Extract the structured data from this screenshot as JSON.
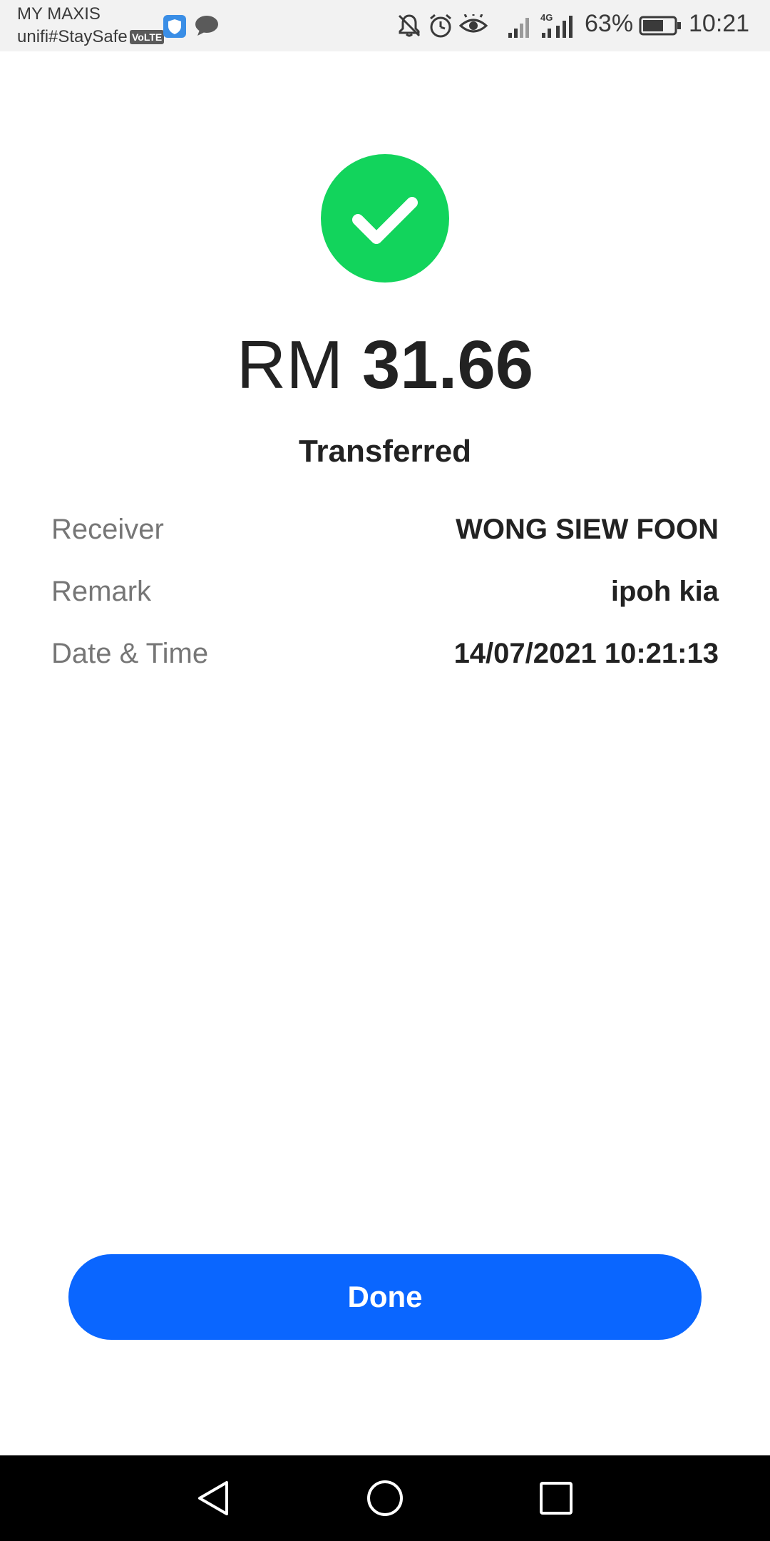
{
  "status_bar": {
    "carrier_line1": "MY MAXIS",
    "carrier_line2": "unifi#StaySafe",
    "volte_badge": "VoLTE",
    "network_badge": "4G",
    "battery_percent": "63%",
    "time": "10:21",
    "icons": [
      "shield-icon",
      "chat-icon",
      "mute-icon",
      "alarm-icon",
      "eye-icon",
      "signal-icon",
      "signal-4g-icon",
      "battery-icon"
    ]
  },
  "receipt": {
    "status_icon": "check-icon",
    "currency": "RM",
    "amount": "31.66",
    "status": "Transferred",
    "details": [
      {
        "label": "Receiver",
        "value": "WONG SIEW FOON"
      },
      {
        "label": "Remark",
        "value": "ipoh kia"
      },
      {
        "label": "Date & Time",
        "value": "14/07/2021 10:21:13"
      }
    ]
  },
  "actions": {
    "done_label": "Done"
  },
  "navigation": {
    "buttons": [
      "back-icon",
      "home-icon",
      "recents-icon"
    ]
  },
  "colors": {
    "success": "#12d45c",
    "primary": "#0a66ff",
    "text": "#222222",
    "label": "#767676"
  }
}
